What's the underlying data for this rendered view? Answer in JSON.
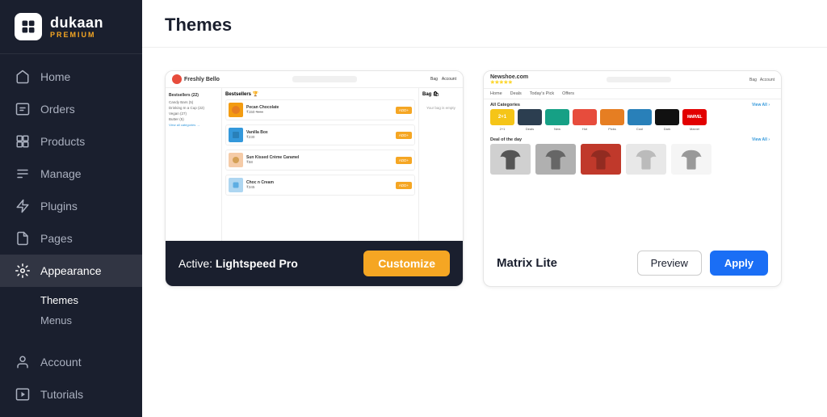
{
  "brand": {
    "name": "dukaan",
    "sub": "PREMIUM"
  },
  "sidebar": {
    "nav_items": [
      {
        "id": "home",
        "label": "Home",
        "icon": "home-icon",
        "active": false
      },
      {
        "id": "orders",
        "label": "Orders",
        "icon": "orders-icon",
        "active": false
      },
      {
        "id": "products",
        "label": "Products",
        "icon": "products-icon",
        "active": false
      },
      {
        "id": "manage",
        "label": "Manage",
        "icon": "manage-icon",
        "active": false
      },
      {
        "id": "plugins",
        "label": "Plugins",
        "icon": "plugins-icon",
        "active": false
      },
      {
        "id": "pages",
        "label": "Pages",
        "icon": "pages-icon",
        "active": false
      }
    ],
    "appearance": {
      "label": "Appearance",
      "icon": "appearance-icon",
      "active": true,
      "children": [
        {
          "id": "themes",
          "label": "Themes",
          "active": true
        },
        {
          "id": "menus",
          "label": "Menus",
          "active": false
        }
      ]
    },
    "bottom_items": [
      {
        "id": "account",
        "label": "Account",
        "icon": "account-icon",
        "active": false
      },
      {
        "id": "tutorials",
        "label": "Tutorials",
        "icon": "tutorials-icon",
        "active": false
      }
    ]
  },
  "main": {
    "title": "Themes",
    "themes": [
      {
        "id": "lightspeed-pro",
        "name": "Lightspeed Pro",
        "is_active": true,
        "active_label": "Active:",
        "active_theme_name": "Lightspeed Pro",
        "customize_label": "Customize"
      },
      {
        "id": "matrix-lite",
        "name": "Matrix Lite",
        "is_active": false,
        "preview_label": "Preview",
        "apply_label": "Apply"
      }
    ]
  }
}
